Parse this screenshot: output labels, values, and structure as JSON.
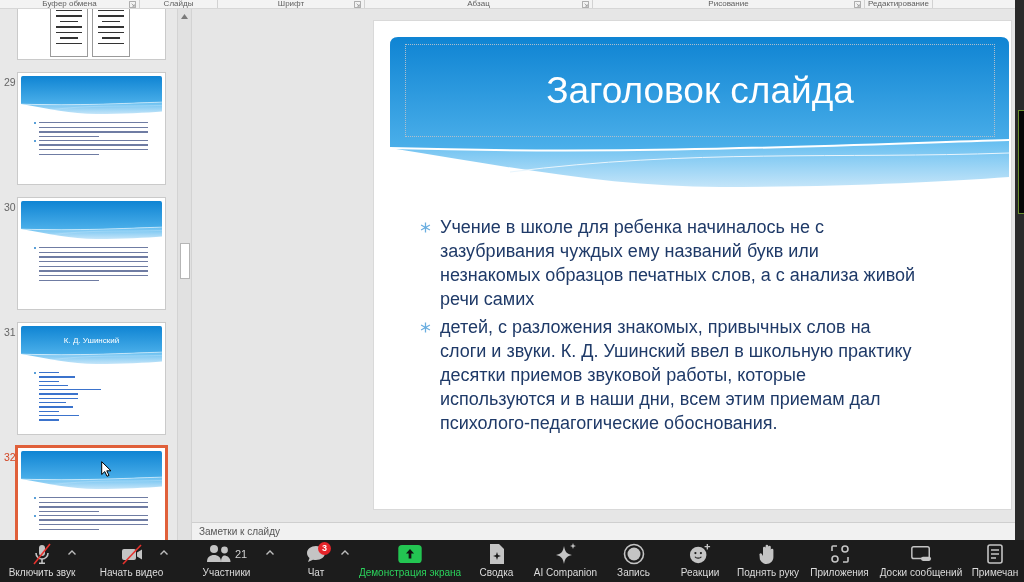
{
  "ribbon": {
    "groups": [
      {
        "label": "Буфер обмена",
        "launcher": true
      },
      {
        "label": "Слайды",
        "launcher": false
      },
      {
        "label": "Шрифт",
        "launcher": true
      },
      {
        "label": "Абзац",
        "launcher": true
      },
      {
        "label": "Рисование",
        "launcher": true
      },
      {
        "label": "Редактирование",
        "launcher": false
      }
    ]
  },
  "slide_panel": {
    "slides": [
      {
        "kind": "scans",
        "selected": false
      },
      {
        "number": "29",
        "kind": "text",
        "selected": false
      },
      {
        "number": "30",
        "kind": "paragraph",
        "selected": false
      },
      {
        "number": "31",
        "kind": "links",
        "title": "К. Д. Ушинский",
        "selected": false
      },
      {
        "number": "32",
        "kind": "text",
        "selected": true
      }
    ]
  },
  "slide": {
    "title": "Заголовок слайда",
    "bullets": [
      "Учение в школе для ребенка начиналось не с зазубривания чуждых ему названий букв или незнакомых образцов печатных слов, а с анализа живой речи самих",
      "детей, с разложения знакомых, привычных слов на слоги и звуки. К. Д. Ушинский ввел в школьную практику десятки приемов звуковой работы, которые используются и в наши дни, всем этим приемам дал психолого-педагогические обоснования."
    ]
  },
  "notes": {
    "placeholder": "Заметки к слайду"
  },
  "meeting_toolbar": {
    "items": [
      {
        "kind": "microphone",
        "label": "Включить звук",
        "muted": true,
        "menu": true
      },
      {
        "kind": "camera",
        "label": "Начать видео",
        "muted": true,
        "menu": true
      },
      {
        "kind": "participants",
        "label": "Участники",
        "count": "21",
        "menu": true
      },
      {
        "kind": "chat",
        "label": "Чат",
        "badge": "3",
        "menu": true
      },
      {
        "kind": "share",
        "label": "Демонстрация экрана",
        "menu": false
      },
      {
        "kind": "summary",
        "label": "Сводка",
        "menu": false
      },
      {
        "kind": "ai",
        "label": "AI Companion",
        "menu": false
      },
      {
        "kind": "record",
        "label": "Запись",
        "menu": false
      },
      {
        "kind": "reactions",
        "label": "Реакции",
        "menu": false
      },
      {
        "kind": "raise_hand",
        "label": "Поднять руку",
        "menu": false
      },
      {
        "kind": "apps",
        "label": "Приложения",
        "menu": false
      },
      {
        "kind": "whiteboards",
        "label": "Доски сообщений",
        "menu": false
      },
      {
        "kind": "notes",
        "label": "Примечан",
        "menu": false
      }
    ]
  }
}
